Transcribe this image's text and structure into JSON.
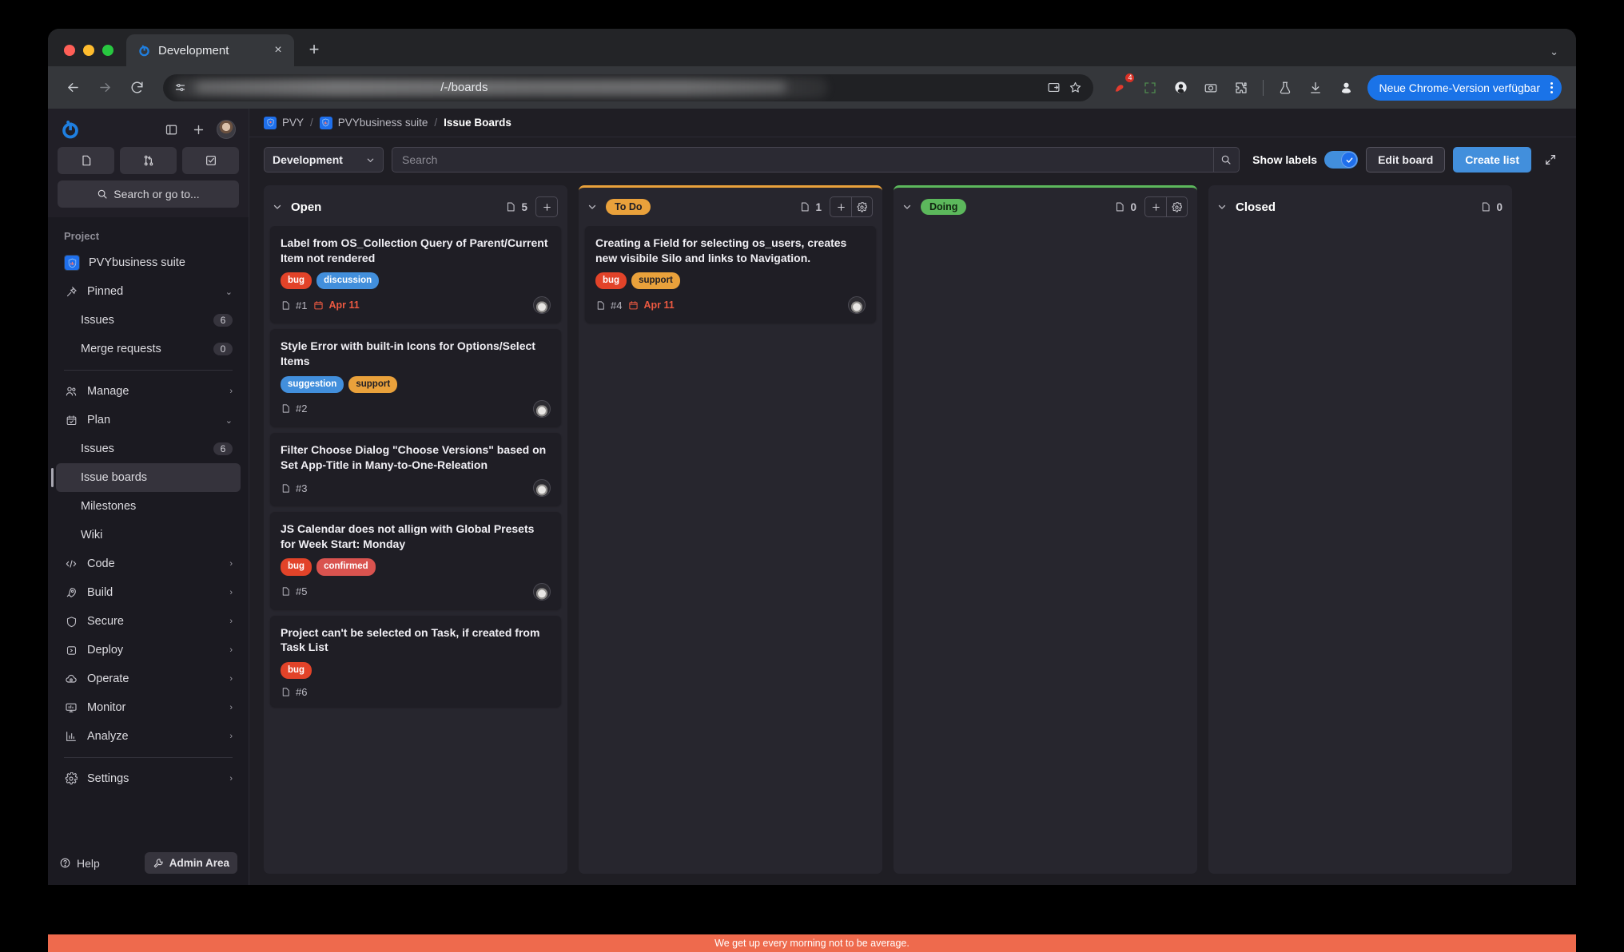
{
  "browser": {
    "tab": {
      "title": "Development",
      "favicon": "gitlab-icon",
      "close": "×"
    },
    "new_tab": "+",
    "url_text": "/-/boards",
    "url_redacted": true,
    "update_button": "Neue Chrome-Version verfügbar",
    "extension_badge_count": "4",
    "toolbar_icons": [
      "back-arrow-icon",
      "forward-arrow-icon",
      "reload-icon",
      "install-app-icon",
      "bookmark-star-icon",
      "extension-puzzle-icon",
      "screen-capture-icon",
      "profile-circle-icon",
      "camera-icon",
      "puzzle-icon",
      "labs-flask-icon",
      "download-icon",
      "account-icon"
    ]
  },
  "sidebar": {
    "brand": "gitlab-logo",
    "quick_actions": [
      "issues-icon",
      "merge-request-icon",
      "todo-check-icon"
    ],
    "search_placeholder": "Search or go to...",
    "section_label": "Project",
    "project": {
      "name": "PVYbusiness suite",
      "avatar": "project-avatar"
    },
    "items": [
      {
        "label": "Pinned",
        "icon": "pin-icon",
        "chevron": "⌄",
        "type": "group"
      },
      {
        "label": "Issues",
        "count": "6",
        "type": "sub"
      },
      {
        "label": "Merge requests",
        "count": "0",
        "type": "sub"
      },
      {
        "label": "Manage",
        "icon": "users-icon",
        "chevron": "›",
        "type": "group"
      },
      {
        "label": "Plan",
        "icon": "calendar-icon",
        "chevron": "⌄",
        "type": "group"
      },
      {
        "label": "Issues",
        "count": "6",
        "type": "sub"
      },
      {
        "label": "Issue boards",
        "type": "sub",
        "active": true
      },
      {
        "label": "Milestones",
        "type": "sub"
      },
      {
        "label": "Wiki",
        "type": "sub"
      },
      {
        "label": "Code",
        "icon": "code-icon",
        "chevron": "›",
        "type": "group"
      },
      {
        "label": "Build",
        "icon": "rocket-icon",
        "chevron": "›",
        "type": "group"
      },
      {
        "label": "Secure",
        "icon": "shield-icon",
        "chevron": "›",
        "type": "group"
      },
      {
        "label": "Deploy",
        "icon": "deploy-icon",
        "chevron": "›",
        "type": "group"
      },
      {
        "label": "Operate",
        "icon": "cloud-icon",
        "chevron": "›",
        "type": "group"
      },
      {
        "label": "Monitor",
        "icon": "monitor-icon",
        "chevron": "›",
        "type": "group"
      },
      {
        "label": "Analyze",
        "icon": "chart-icon",
        "chevron": "›",
        "type": "group"
      },
      {
        "label": "Settings",
        "icon": "gear-icon",
        "chevron": "›",
        "type": "group"
      }
    ],
    "help_label": "Help",
    "admin_label": "Admin Area"
  },
  "breadcrumb": {
    "items": [
      "PVY",
      "PVYbusiness suite"
    ],
    "separator": "/",
    "current": "Issue Boards"
  },
  "board_toolbar": {
    "board_name": "Development",
    "search_placeholder": "Search",
    "show_labels_label": "Show labels",
    "show_labels_on": true,
    "edit_board_label": "Edit board",
    "create_list_label": "Create list",
    "expand_icon": "fullscreen-icon"
  },
  "colors": {
    "accent_blue": "#428fdc",
    "label_bug": "#e24329",
    "label_discussion": "#428fdc",
    "label_suggestion": "#428fdc",
    "label_support": "#e9a13b",
    "label_confirmed": "#d9534f",
    "todo_orange": "#e9a13b",
    "doing_green": "#5cb85c",
    "banner_orange": "#ee6a4d",
    "due_red": "#ec5941"
  },
  "banner": {
    "text": "We get up every morning not to be average."
  },
  "board": {
    "columns": [
      {
        "title": "Open",
        "is_badge": false,
        "accent": "transparent",
        "count": "5",
        "has_add": true,
        "has_settings": false,
        "cards": [
          {
            "title": "Label from OS_Collection Query of Parent/Current Item not rendered",
            "labels": [
              {
                "text": "bug",
                "color": "#e24329",
                "fg": "#ffffff"
              },
              {
                "text": "discussion",
                "color": "#428fdc",
                "fg": "#ffffff"
              }
            ],
            "id": "#1",
            "due": "Apr 11",
            "has_avatar": true
          },
          {
            "title": "Style Error with built-in Icons for Options/Select Items",
            "labels": [
              {
                "text": "suggestion",
                "color": "#428fdc",
                "fg": "#ffffff"
              },
              {
                "text": "support",
                "color": "#e9a13b",
                "fg": "#1f1e25"
              }
            ],
            "id": "#2",
            "due": "",
            "has_avatar": true
          },
          {
            "title": "Filter Choose Dialog \"Choose Versions\" based on Set App-Title in Many-to-One-Releation",
            "labels": [],
            "id": "#3",
            "due": "",
            "has_avatar": true
          },
          {
            "title": "JS Calendar does not allign with Global Presets for Week Start: Monday",
            "labels": [
              {
                "text": "bug",
                "color": "#e24329",
                "fg": "#ffffff"
              },
              {
                "text": "confirmed",
                "color": "#d9534f",
                "fg": "#ffffff"
              }
            ],
            "id": "#5",
            "due": "",
            "has_avatar": true
          },
          {
            "title": "Project can't be selected on Task, if created from Task List",
            "labels": [
              {
                "text": "bug",
                "color": "#e24329",
                "fg": "#ffffff"
              }
            ],
            "id": "#6",
            "due": "",
            "has_avatar": false
          }
        ]
      },
      {
        "title": "To Do",
        "is_badge": true,
        "badge_color": "#e9a13b",
        "badge_fg": "#1f1e25",
        "accent": "#e9a13b",
        "count": "1",
        "has_add": true,
        "has_settings": true,
        "cards": [
          {
            "title": "Creating a Field for selecting os_users, creates new visibile Silo and links to Navigation.",
            "labels": [
              {
                "text": "bug",
                "color": "#e24329",
                "fg": "#ffffff"
              },
              {
                "text": "support",
                "color": "#e9a13b",
                "fg": "#1f1e25"
              }
            ],
            "id": "#4",
            "due": "Apr 11",
            "has_avatar": true
          }
        ]
      },
      {
        "title": "Doing",
        "is_badge": true,
        "badge_color": "#5cb85c",
        "badge_fg": "#10230f",
        "accent": "#5cb85c",
        "count": "0",
        "has_add": true,
        "has_settings": true,
        "cards": []
      },
      {
        "title": "Closed",
        "is_badge": false,
        "accent": "transparent",
        "count": "0",
        "has_add": false,
        "has_settings": false,
        "cards": []
      }
    ]
  }
}
